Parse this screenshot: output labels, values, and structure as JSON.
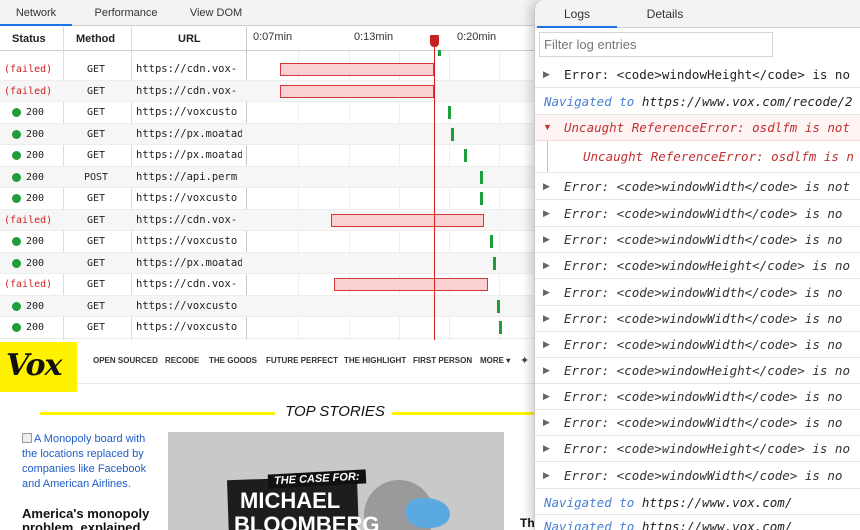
{
  "network": {
    "tabs": [
      "Network",
      "Performance",
      "View DOM"
    ],
    "columns": {
      "status": "Status",
      "method": "Method",
      "url": "URL"
    },
    "time_marks": [
      "0:07min",
      "0:13min",
      "0:20min"
    ],
    "rows": [
      {
        "status": "(failed)",
        "method": "GET",
        "url": "https://cdn.vox-"
      },
      {
        "status": "(failed)",
        "method": "GET",
        "url": "https://cdn.vox-"
      },
      {
        "status": "200",
        "method": "GET",
        "url": "https://voxcusto"
      },
      {
        "status": "200",
        "method": "GET",
        "url": "https://px.moatad"
      },
      {
        "status": "200",
        "method": "GET",
        "url": "https://px.moatad"
      },
      {
        "status": "200",
        "method": "POST",
        "url": "https://api.perm"
      },
      {
        "status": "200",
        "method": "GET",
        "url": "https://voxcusto"
      },
      {
        "status": "(failed)",
        "method": "GET",
        "url": "https://cdn.vox-"
      },
      {
        "status": "200",
        "method": "GET",
        "url": "https://voxcusto"
      },
      {
        "status": "200",
        "method": "GET",
        "url": "https://px.moatad"
      },
      {
        "status": "(failed)",
        "method": "GET",
        "url": "https://cdn.vox-"
      },
      {
        "status": "200",
        "method": "GET",
        "url": "https://voxcusto"
      },
      {
        "status": "200",
        "method": "GET",
        "url": "https://voxcusto"
      }
    ]
  },
  "vox": {
    "logo": "Vox",
    "nav": [
      "OPEN SOURCED",
      "RECODE",
      "THE GOODS",
      "FUTURE PERFECT",
      "THE HIGHLIGHT",
      "FIRST PERSON",
      "MORE ▾"
    ],
    "section_title": "TOP STORIES",
    "story_image_alt": "A Monopoly board with the locations replaced by companies like Facebook and American Airlines.",
    "story_headline": "America's monopoly problem, explained",
    "feature_kicker": "THE CASE FOR:",
    "feature_name_1": "MICHAEL",
    "feature_name_2": "BLOOMBERG",
    "cut_text": "Th"
  },
  "logs": {
    "tabs": [
      "Logs",
      "Details"
    ],
    "filter_placeholder": "Filter log entries",
    "entries": [
      {
        "kind": "plain",
        "text": "Error: <code>windowHeight</code> is no"
      },
      {
        "kind": "nav",
        "prefix": "Navigated to",
        "url": "https://www.vox.com/recode/2"
      },
      {
        "kind": "err",
        "text": "Uncaught ReferenceError: osdlfm is not"
      },
      {
        "kind": "sub",
        "text": "Uncaught ReferenceError: osdlfm is n"
      },
      {
        "kind": "italic",
        "text": "Error: <code>windowWidth</code> is not"
      },
      {
        "kind": "italic",
        "text": "Error: <code>windowWidth</code> is no"
      },
      {
        "kind": "italic",
        "text": "Error: <code>windowWidth</code> is no"
      },
      {
        "kind": "italic",
        "text": "Error: <code>windowHeight</code> is no"
      },
      {
        "kind": "italic",
        "text": "Error: <code>windowWidth</code> is no"
      },
      {
        "kind": "italic",
        "text": "Error: <code>windowWidth</code> is no"
      },
      {
        "kind": "italic",
        "text": "Error: <code>windowWidth</code> is no"
      },
      {
        "kind": "italic",
        "text": "Error: <code>windowHeight</code> is no"
      },
      {
        "kind": "italic",
        "text": "Error: <code>windowWidth</code> is no"
      },
      {
        "kind": "italic",
        "text": "Error: <code>windowWidth</code> is no"
      },
      {
        "kind": "italic",
        "text": "Error: <code>windowHeight</code> is no"
      },
      {
        "kind": "italic",
        "text": "Error: <code>windowWidth</code> is no"
      },
      {
        "kind": "nav",
        "prefix": "Navigated to",
        "url": "https://www.vox.com/"
      },
      {
        "kind": "nav",
        "prefix": "Navigated to",
        "url": "https://www.vox.com/"
      }
    ]
  },
  "colors": {
    "failed_text": "#d02020",
    "ok_dot": "#1e9e3a",
    "failed_bar_fill": "#fbd0d3",
    "playhead": "#d02020",
    "vox_yellow": "#fff200",
    "nav_link": "#4a7fd0"
  }
}
